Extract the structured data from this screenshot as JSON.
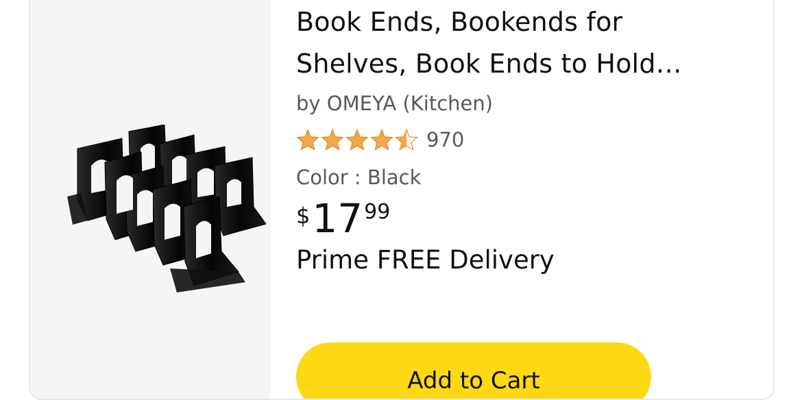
{
  "product": {
    "title": "Book Ends, Bookends for Shelves, Book Ends to Hold Heavy Books",
    "byline": "by OMEYA (Kitchen)",
    "rating": 4.5,
    "rating_count": "970",
    "color_line": "Color : Black",
    "price": {
      "symbol": "$",
      "whole": "17",
      "fraction": "99"
    },
    "delivery": "Prime FREE Delivery",
    "add_to_cart_label": "Add to Cart",
    "image_alt": "black metal bookends set"
  },
  "colors": {
    "star": "#f3a847",
    "button": "#ffd814",
    "secondary_text": "#565959"
  }
}
